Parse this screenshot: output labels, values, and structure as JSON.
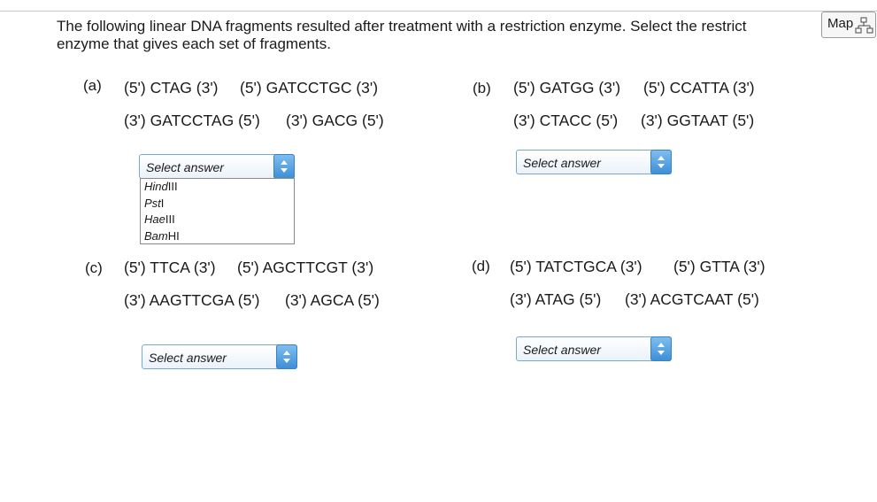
{
  "instructions": {
    "line1": "The following linear DNA fragments resulted after treatment with a restriction enzyme. Select the restrict",
    "line2": "enzyme that gives each set of fragments."
  },
  "map_button": {
    "label": "Map",
    "icon": "map-icon"
  },
  "problems": {
    "a": {
      "label": "(a)",
      "top_frag1": "(5') CTAG (3')",
      "top_frag2": "(5') GATCCTGC (3')",
      "bot_frag1": "(3') GATCCTAG (5')",
      "bot_frag2": "(3') GACG (5')",
      "select": "Select answer"
    },
    "b": {
      "label": "(b)",
      "top_frag1": "(5') GATGG (3')",
      "top_frag2": "(5') CCATTA (3')",
      "bot_frag1": "(3') CTACC (5')",
      "bot_frag2": "(3') GGTAAT (5')",
      "select": "Select answer"
    },
    "c": {
      "label": "(c)",
      "top_frag1": "(5') TTCA (3')",
      "top_frag2": "(5') AGCTTCGT (3')",
      "bot_frag1": "(3') AAGTTCGA (5')",
      "bot_frag2": "(3') AGCA (5')",
      "select": "Select answer"
    },
    "d": {
      "label": "(d)",
      "top_frag1": "(5') TATCTGCA (3')",
      "top_frag2": "(5') GTTA (3')",
      "bot_frag1": "(3') ATAG (5')",
      "bot_frag2": "(3') ACGTCAAT (5')",
      "select": "Select answer"
    }
  },
  "dropdown_options": [
    {
      "italic": "Hind",
      "rest": "III"
    },
    {
      "italic": "Pst",
      "rest": "I"
    },
    {
      "italic": "Hae",
      "rest": "III"
    },
    {
      "italic": "Bam",
      "rest": "HI"
    }
  ],
  "colors": {
    "select_border": "#7aa9cf",
    "select_arrow": "#3d8fd8"
  }
}
